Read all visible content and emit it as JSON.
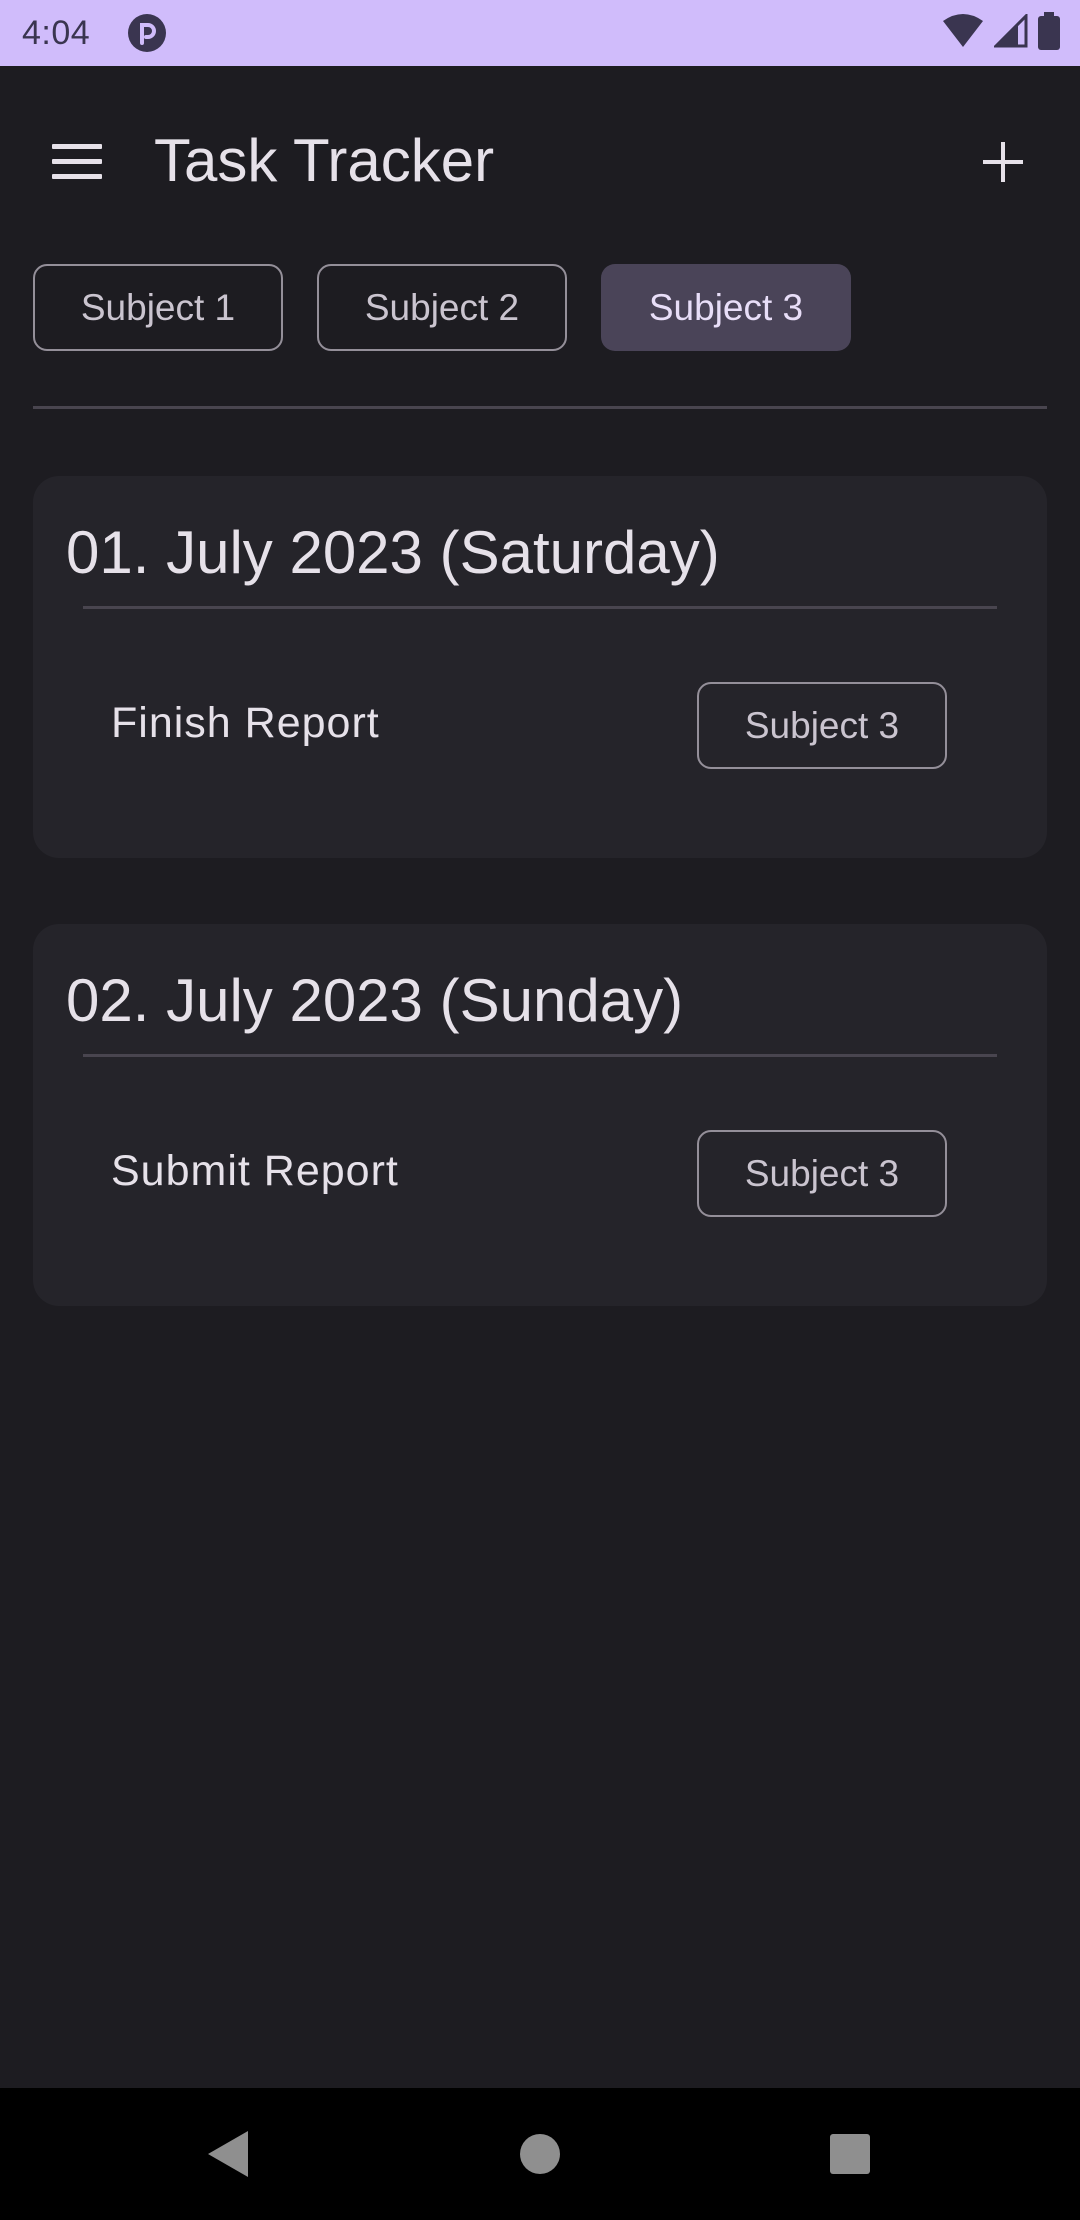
{
  "status_bar": {
    "time": "4:04",
    "icons": [
      "app-notification-icon",
      "wifi-icon",
      "cellular-signal-icon",
      "battery-icon"
    ]
  },
  "app_bar": {
    "title": "Task Tracker",
    "menu_icon": "hamburger-menu-icon",
    "add_icon": "plus-icon"
  },
  "filter_chips": [
    {
      "label": "Subject 1",
      "selected": false
    },
    {
      "label": "Subject 2",
      "selected": false
    },
    {
      "label": "Subject 3",
      "selected": true
    }
  ],
  "day_cards": [
    {
      "date": "01. July 2023 (Saturday)",
      "task": "Finish Report",
      "subject": "Subject 3"
    },
    {
      "date": "02. July 2023 (Sunday)",
      "task": "Submit Report",
      "subject": "Subject 3"
    }
  ],
  "nav_bar": {
    "buttons": [
      "back-icon",
      "home-icon",
      "recents-icon"
    ]
  },
  "colors": {
    "background": "#1d1c21",
    "status_bar": "#d0bcfb",
    "card": "#25242a",
    "selected_chip": "#4a4458",
    "text": "#e6e1e9",
    "outline": "#948f99"
  }
}
